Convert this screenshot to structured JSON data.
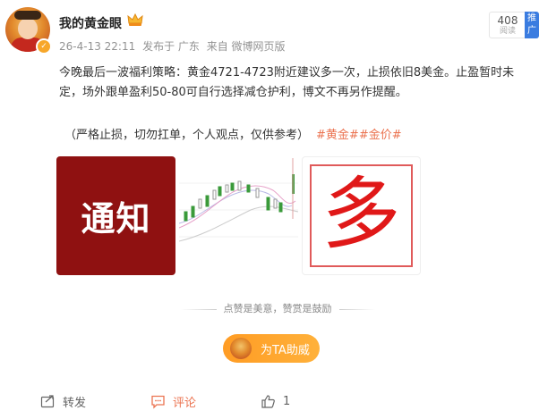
{
  "user": {
    "name": "我的黄金眼"
  },
  "meta": {
    "date": "26-4-13 22:11",
    "location": "发布于 广东",
    "source": "来自 微博网页版"
  },
  "stats": {
    "reads": "408",
    "reads_label": "阅读",
    "push": "推广"
  },
  "post": {
    "text": "今晚最后一波福利策略：黄金4721-4723附近建议多一次，止损依旧8美金。止盈暂时未定，场外跟单盈利50-80可自行选择减仓护利，博文不再另作提醒。",
    "note": "（严格止损，切勿扛单，个人观点，仅供参考）",
    "tags": [
      "#黄金#",
      "#金价#"
    ]
  },
  "images": {
    "img1_text": "通知",
    "img3_text": "多"
  },
  "like_hint": "点赞是美意，赞赏是鼓励",
  "support_button": "为TA助威",
  "actions": {
    "repost": "转发",
    "comment": "评论",
    "like_count": "1"
  },
  "colors": {
    "accent": "#eb7350",
    "support": "#ffa12c",
    "badge": "#3a7ce0"
  }
}
